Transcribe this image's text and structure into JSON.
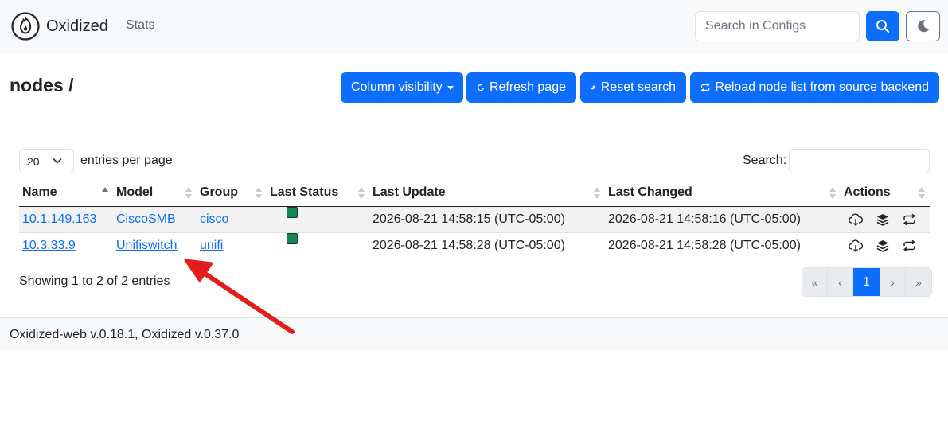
{
  "navbar": {
    "brand": "Oxidized",
    "stats_link": "Stats",
    "search_placeholder": "Search in Configs",
    "search_icon": "search-icon",
    "theme_icon": "moon-icon"
  },
  "page": {
    "title": "nodes /"
  },
  "toolbar": {
    "column_visibility": "Column visibility",
    "refresh": "Refresh page",
    "reset_search": "Reset search",
    "reload": "Reload node list from source backend"
  },
  "datatable": {
    "per_page_value": "20",
    "per_page_label": "entries per page",
    "search_label": "Search:",
    "columns": [
      "Name",
      "Model",
      "Group",
      "Last Status",
      "Last Update",
      "Last Changed",
      "Actions"
    ],
    "rows": [
      {
        "name": "10.1.149.163",
        "model": "CiscoSMB",
        "group": "cisco",
        "status": "success",
        "last_update": "2026-08-21 14:58:15 (UTC-05:00)",
        "last_changed": "2026-08-21 14:58:16 (UTC-05:00)"
      },
      {
        "name": "10.3.33.9",
        "model": "Unifiswitch",
        "group": "unifi",
        "status": "success",
        "last_update": "2026-08-21 14:58:28 (UTC-05:00)",
        "last_changed": "2026-08-21 14:58:28 (UTC-05:00)"
      }
    ],
    "info": "Showing 1 to 2 of 2 entries",
    "pagination": {
      "first": "«",
      "prev": "‹",
      "current": "1",
      "next": "›",
      "last": "»"
    }
  },
  "footer": {
    "text": "Oxidized-web v.0.18.1, Oxidized v.0.37.0"
  },
  "colors": {
    "primary": "#0d6efd",
    "status_success": "#198754",
    "annotation_arrow": "#e11d1d"
  }
}
